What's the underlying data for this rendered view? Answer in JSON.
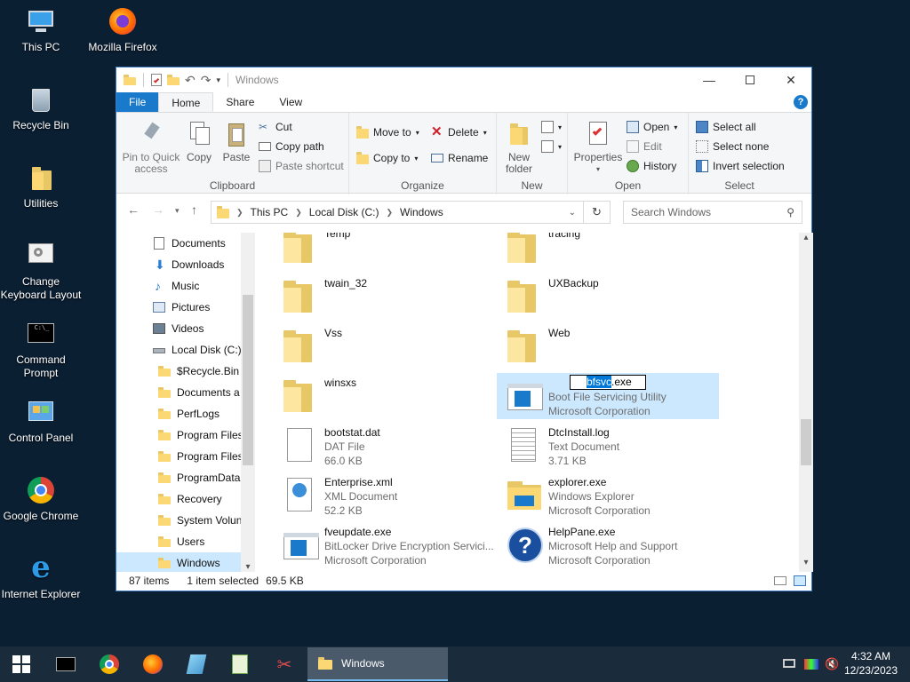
{
  "desktop": {
    "icons": [
      {
        "label": "This PC"
      },
      {
        "label": "Mozilla Firefox"
      },
      {
        "label": "Recycle Bin"
      },
      {
        "label": "Utilities"
      },
      {
        "label": "Change Keyboard Layout"
      },
      {
        "label": "Command Prompt"
      },
      {
        "label": "Control Panel"
      },
      {
        "label": "Google Chrome"
      },
      {
        "label": "Internet Explorer"
      }
    ]
  },
  "window": {
    "title": "Windows",
    "tabs": {
      "file": "File",
      "home": "Home",
      "share": "Share",
      "view": "View"
    },
    "help": "?",
    "ribbon": {
      "clipboard": {
        "label": "Clipboard",
        "pin": "Pin to Quick access",
        "copy": "Copy",
        "paste": "Paste",
        "cut": "Cut",
        "copy_path": "Copy path",
        "paste_shortcut": "Paste shortcut"
      },
      "organize": {
        "label": "Organize",
        "move_to": "Move to",
        "copy_to": "Copy to",
        "delete": "Delete",
        "rename": "Rename"
      },
      "new": {
        "label": "New",
        "new_folder": "New folder"
      },
      "open": {
        "label": "Open",
        "properties": "Properties",
        "open": "Open",
        "edit": "Edit",
        "history": "History"
      },
      "select": {
        "label": "Select",
        "select_all": "Select all",
        "select_none": "Select none",
        "invert": "Invert selection"
      }
    },
    "address": {
      "crumbs": [
        "This PC",
        "Local Disk (C:)",
        "Windows"
      ],
      "search_placeholder": "Search Windows"
    },
    "nav": [
      {
        "label": "Documents",
        "icon": "documents-icon"
      },
      {
        "label": "Downloads",
        "icon": "downloads-icon"
      },
      {
        "label": "Music",
        "icon": "music-icon"
      },
      {
        "label": "Pictures",
        "icon": "pictures-icon"
      },
      {
        "label": "Videos",
        "icon": "videos-icon"
      },
      {
        "label": "Local Disk (C:)",
        "icon": "drive-icon"
      },
      {
        "label": "$Recycle.Bin",
        "icon": "folder-icon"
      },
      {
        "label": "Documents a",
        "icon": "folder-icon"
      },
      {
        "label": "PerfLogs",
        "icon": "folder-icon"
      },
      {
        "label": "Program Files",
        "icon": "folder-icon"
      },
      {
        "label": "Program Files",
        "icon": "folder-icon"
      },
      {
        "label": "ProgramData",
        "icon": "folder-icon"
      },
      {
        "label": "Recovery",
        "icon": "folder-icon"
      },
      {
        "label": "System Volun",
        "icon": "folder-icon"
      },
      {
        "label": "Users",
        "icon": "folder-icon"
      },
      {
        "label": "Windows",
        "icon": "folder-icon"
      }
    ],
    "files": [
      {
        "name": "Temp",
        "l2": "",
        "l3": "",
        "kind": "folder"
      },
      {
        "name": "tracing",
        "l2": "",
        "l3": "",
        "kind": "folder"
      },
      {
        "name": "twain_32",
        "l2": "",
        "l3": "",
        "kind": "folder"
      },
      {
        "name": "UXBackup",
        "l2": "",
        "l3": "",
        "kind": "folder"
      },
      {
        "name": "Vss",
        "l2": "",
        "l3": "",
        "kind": "folder"
      },
      {
        "name": "Web",
        "l2": "",
        "l3": "",
        "kind": "folder"
      },
      {
        "name": "winsxs",
        "l2": "",
        "l3": "",
        "kind": "folder"
      },
      {
        "name": "bfsvc.exe",
        "l2": "Boot File Servicing Utility",
        "l3": "Microsoft Corporation",
        "kind": "exe"
      },
      {
        "name": "bootstat.dat",
        "l2": "DAT File",
        "l3": "66.0 KB",
        "kind": "file"
      },
      {
        "name": "DtcInstall.log",
        "l2": "Text Document",
        "l3": "3.71 KB",
        "kind": "text"
      },
      {
        "name": "Enterprise.xml",
        "l2": "XML Document",
        "l3": "52.2 KB",
        "kind": "xml"
      },
      {
        "name": "explorer.exe",
        "l2": "Windows Explorer",
        "l3": "Microsoft Corporation",
        "kind": "explorer"
      },
      {
        "name": "fveupdate.exe",
        "l2": "BitLocker Drive Encryption Servici...",
        "l3": "Microsoft Corporation",
        "kind": "exe"
      },
      {
        "name": "HelpPane.exe",
        "l2": "Microsoft Help and Support",
        "l3": "Microsoft Corporation",
        "kind": "help"
      }
    ],
    "rename": {
      "selected": "bfsvc",
      "rest": ".exe"
    },
    "status": {
      "count": "87 items",
      "selected": "1 item selected",
      "size": "69.5 KB"
    }
  },
  "taskbar": {
    "window_label": "Windows",
    "time": "4:32 AM",
    "date": "12/23/2023"
  },
  "colors": {
    "accent": "#1979ca",
    "selection": "#cce8ff",
    "folder": "#fcd874",
    "desktop": "#0b1f33"
  }
}
